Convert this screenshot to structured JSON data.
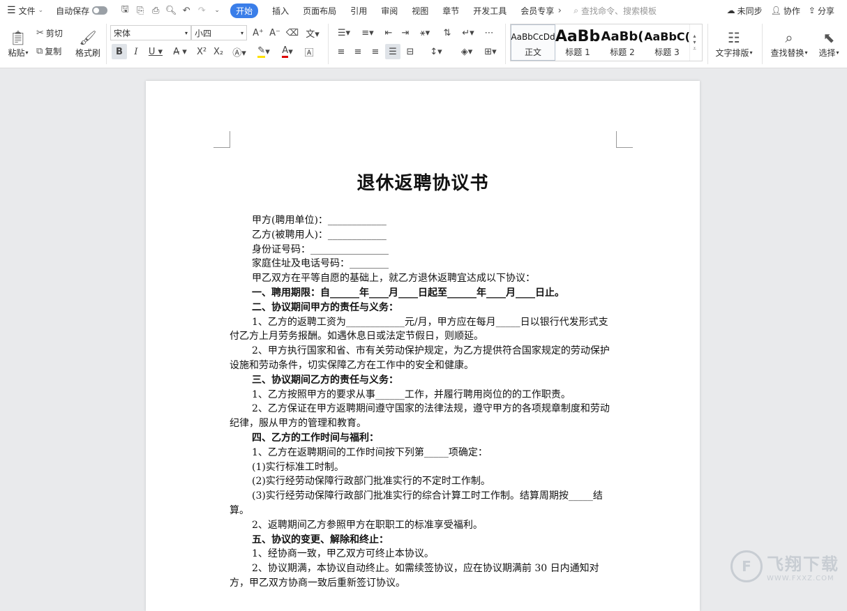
{
  "titlebar": {
    "menu_label": "文件",
    "autosave_label": "自动保存",
    "tabs": [
      "开始",
      "插入",
      "页面布局",
      "引用",
      "审阅",
      "视图",
      "章节",
      "开发工具",
      "会员专享"
    ],
    "active_tab": "开始",
    "search_placeholder": "查找命令、搜索模板",
    "unsync_label": "未同步",
    "collab_label": "协作",
    "share_label": "分享"
  },
  "ribbon": {
    "paste": "粘贴",
    "cut": "剪切",
    "copy": "复制",
    "format_painter": "格式刷",
    "font_name": "宋体",
    "font_size": "小四",
    "styles": [
      {
        "preview": "AaBbCcDd",
        "name": "正文"
      },
      {
        "preview": "AaBb",
        "name": "标题 1"
      },
      {
        "preview": "AaBb(",
        "name": "标题 2"
      },
      {
        "preview": "AaBbC(",
        "name": "标题 3"
      }
    ],
    "text_layout": "文字排版",
    "find_replace": "查找替换",
    "select": "选择"
  },
  "document": {
    "title": "退休返聘协议书",
    "paragraphs": [
      {
        "text": "甲方(聘用单位)：____________",
        "bold": false
      },
      {
        "text": "乙方(被聘用人)：____________",
        "bold": false
      },
      {
        "text": "身份证号码：________________",
        "bold": false
      },
      {
        "text": "家庭住址及电话号码：________",
        "bold": false
      },
      {
        "text": "甲乙双方在平等自愿的基础上，就乙方退休返聘宜达成以下协议：",
        "bold": false
      },
      {
        "text": "一、聘用期限：自______年____月____日起至______年____月____日止。",
        "bold": true
      },
      {
        "text": "二、协议期间甲方的责任与义务：",
        "bold": true
      },
      {
        "text": "1、乙方的返聘工资为____________元/月，甲方应在每月_____日以银行代发形式支付乙方上月劳务报酬。如遇休息日或法定节假日，则顺延。",
        "bold": false
      },
      {
        "text": "2、甲方执行国家和省、市有关劳动保护规定，为乙方提供符合国家规定的劳动保护设施和劳动条件，切实保障乙方在工作中的安全和健康。",
        "bold": false
      },
      {
        "text": "三、协议期间乙方的责任与义务：",
        "bold": true
      },
      {
        "text": "1、乙方按照甲方的要求从事______工作，并履行聘用岗位的的工作职责。",
        "bold": false
      },
      {
        "text": "2、乙方保证在甲方返聘期间遵守国家的法律法规，遵守甲方的各项规章制度和劳动纪律，服从甲方的管理和教育。",
        "bold": false
      },
      {
        "text": "四、乙方的工作时间与福利：",
        "bold": true
      },
      {
        "text": "1、乙方在返聘期间的工作时间按下列第_____项确定：",
        "bold": false
      },
      {
        "text": "(1)实行标准工时制。",
        "bold": false
      },
      {
        "text": "(2)实行经劳动保障行政部门批准实行的不定时工作制。",
        "bold": false
      },
      {
        "text": "(3)实行经劳动保障行政部门批准实行的综合计算工时工作制。结算周期按_____结算。",
        "bold": false
      },
      {
        "text": "2、返聘期间乙方参照甲方在职职工的标准享受福利。",
        "bold": false
      },
      {
        "text": "五、协议的变更、解除和终止：",
        "bold": true
      },
      {
        "text": "1、经协商一致，甲乙双方可终止本协议。",
        "bold": false
      },
      {
        "text": "2、协议期满，本协议自动终止。如需续签协议，应在协议期满前 30 日内通知对方，甲乙双方协商一致后重新签订协议。",
        "bold": false
      }
    ]
  },
  "watermark": {
    "brand": "飞翔下载",
    "url": "WWW.FXXZ.COM"
  }
}
